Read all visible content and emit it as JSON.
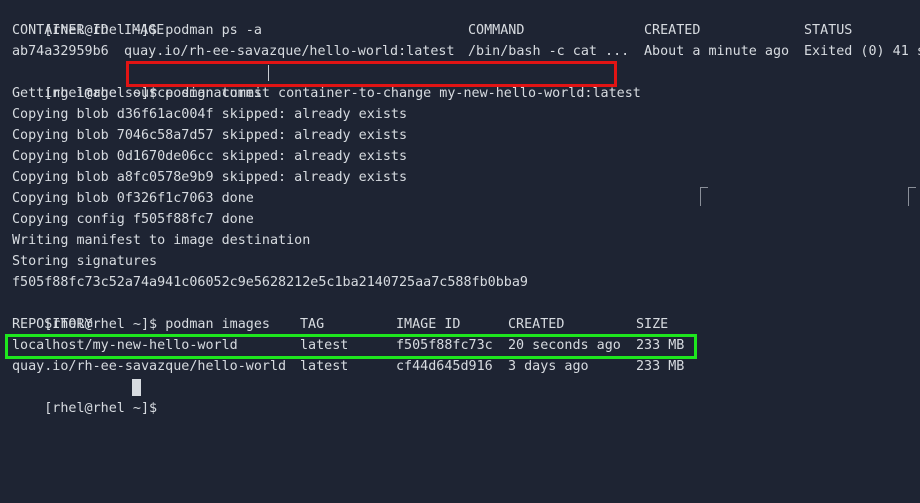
{
  "prompt": "[rhel@rhel ~]$",
  "cmd_ps": "podman ps -a",
  "ps": {
    "headers": [
      "CONTAINER ID",
      "IMAGE",
      "COMMAND",
      "CREATED",
      "STATUS"
    ],
    "row": [
      "ab74a32959b6",
      "quay.io/rh-ee-savazque/hello-world:latest",
      "/bin/bash -c cat ...",
      "About a minute ago",
      "Exited (0) 41 s"
    ]
  },
  "cmd_commit": "podman commit container-to-change my-new-hello-world:latest",
  "commit_output": [
    "Getting image source signatures",
    "Copying blob d36f61ac004f skipped: already exists",
    "Copying blob 7046c58a7d57 skipped: already exists",
    "Copying blob 0d1670de06cc skipped: already exists",
    "Copying blob a8fc0578e9b9 skipped: already exists",
    "Copying blob 0f326f1c7063 done",
    "Copying config f505f88fc7 done",
    "Writing manifest to image destination",
    "Storing signatures",
    "f505f88fc73c52a74a941c06052c9e5628212e5c1ba2140725aa7c588fb0bba9"
  ],
  "cmd_images": "podman images",
  "images": {
    "headers": [
      "REPOSITORY",
      "TAG",
      "IMAGE ID",
      "CREATED",
      "SIZE"
    ],
    "rows": [
      [
        "localhost/my-new-hello-world",
        "latest",
        "f505f88fc73c",
        "20 seconds ago",
        "233 MB"
      ],
      [
        "quay.io/rh-ee-savazque/hello-world",
        "latest",
        "cf44d645d916",
        "3 days ago",
        "233 MB"
      ]
    ]
  },
  "colors": {
    "background": "#1e2433",
    "text": "#d7dbe0",
    "highlight_command": "#e21414",
    "highlight_row": "#1ee61e"
  }
}
